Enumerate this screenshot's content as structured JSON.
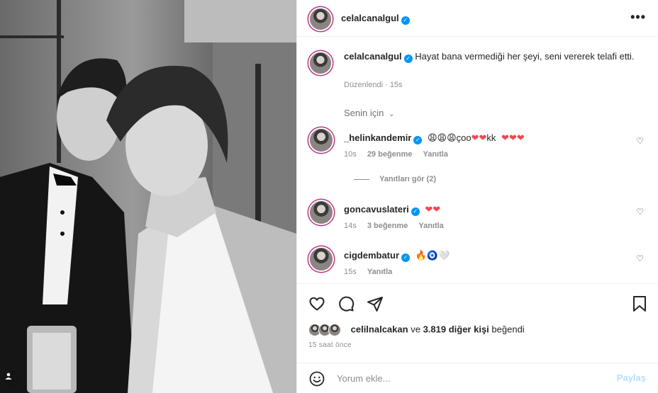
{
  "post": {
    "username": "celalcanalgul",
    "caption": "Hayat bana vermediği her şeyi, seni vererek telafi etti.",
    "edited_label": "Düzenlendi · 15s",
    "for_you_label": "Senin için"
  },
  "comments": [
    {
      "username": "_helinkandemir",
      "text": "😩😩😩çoo",
      "hearts": "❤❤",
      "text2": "kk",
      "hearts2": "❤❤❤",
      "time": "10s",
      "likes": "29 beğenme",
      "reply": "Yanıtla",
      "view_replies": "Yanıtları gör (2)"
    },
    {
      "username": "goncavuslateri",
      "hearts": "❤❤",
      "time": "14s",
      "likes": "3 beğenme",
      "reply": "Yanıtla"
    },
    {
      "username": "cigdembatur",
      "emojis": "🔥🧿🤍",
      "time": "15s",
      "reply": "Yanıtla"
    }
  ],
  "likes": {
    "first_user": "celilnalcakan",
    "connector": "ve",
    "others": "3.819 diğer kişi",
    "suffix": "beğendi"
  },
  "time_ago": "15 saat önce",
  "add_comment": {
    "placeholder": "Yorum ekle...",
    "post_label": "Paylaş"
  },
  "icons": {
    "more": "more-horizontal-icon",
    "like": "heart-outline-icon",
    "comment": "comment-icon",
    "share": "send-icon",
    "save": "bookmark-icon",
    "emoji": "smiley-icon",
    "tagged": "person-tag-icon"
  },
  "colors": {
    "verified": "#0095f6",
    "heart": "#ed4956",
    "muted": "#8e8e8e",
    "post_button": "#b2dffc"
  }
}
